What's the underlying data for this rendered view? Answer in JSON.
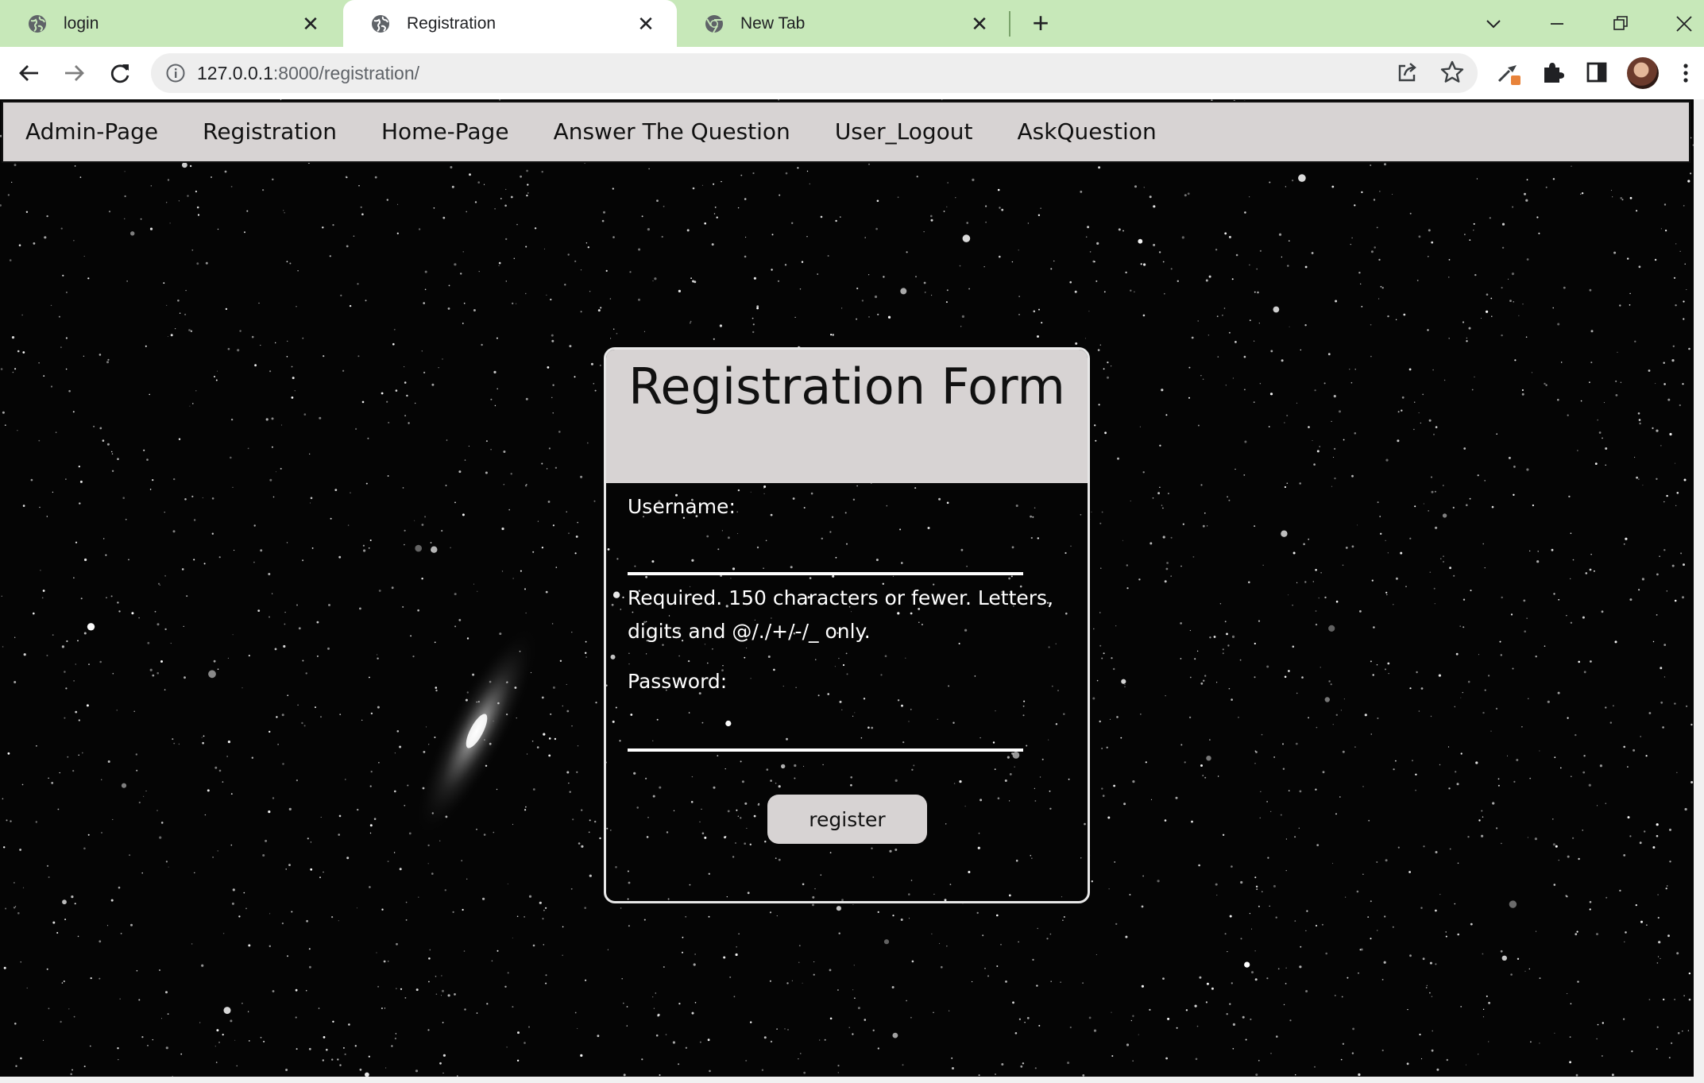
{
  "browser": {
    "tabs": [
      {
        "title": "login",
        "active": false,
        "favicon": "globe-icon"
      },
      {
        "title": "Registration",
        "active": true,
        "favicon": "globe-icon"
      },
      {
        "title": "New Tab",
        "active": false,
        "favicon": "chrome-icon"
      }
    ],
    "address": {
      "host": "127.0.0.1",
      "rest": ":8000/registration/"
    }
  },
  "site_nav": {
    "items": [
      "Admin-Page",
      "Registration",
      "Home-Page",
      "Answer The Question",
      "User_Logout",
      "AskQuestion"
    ]
  },
  "form": {
    "title": "Registration Form",
    "username_label": "Username:",
    "username_value": "",
    "help_text": "Required. 150 characters or fewer. Letters, digits and @/./+/-/_ only.",
    "password_label": "Password:",
    "password_value": "",
    "submit_label": "register"
  },
  "colors": {
    "tab_strip": "#c7e8b9",
    "nav_background": "#d7d3d3",
    "page_background": "#050505"
  }
}
